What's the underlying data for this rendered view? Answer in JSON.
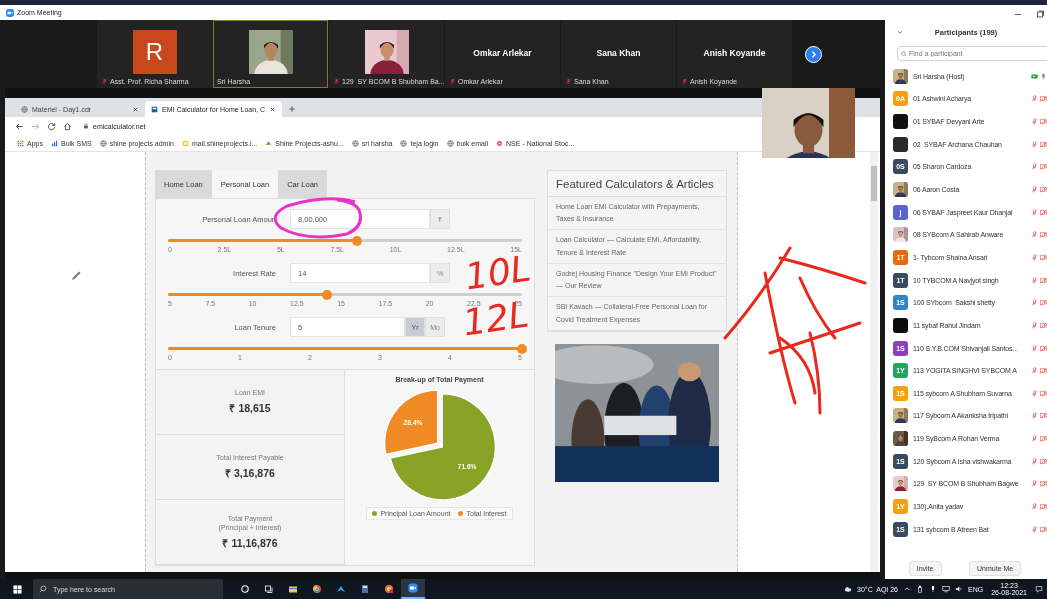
{
  "window": {
    "title": "Zoom Meeting"
  },
  "video_strip": {
    "tiles": [
      {
        "kind": "initial",
        "initial": "R",
        "color": "#c8471b",
        "label": "Asst. Prof. Richa Sharma",
        "muted": true,
        "speaking": false
      },
      {
        "kind": "picture",
        "label": "Sri Harsha",
        "muted": false,
        "speaking": true
      },
      {
        "kind": "picture",
        "label": "129  SY BCOM B Shubham Ba...",
        "muted": true,
        "speaking": false
      },
      {
        "kind": "name",
        "name": "Omkar Arlekar",
        "label": "Omkar Arlekar",
        "muted": true,
        "speaking": false
      },
      {
        "kind": "name",
        "name": "Sana Khan",
        "label": "Sana Khan",
        "muted": true,
        "speaking": false
      },
      {
        "kind": "name",
        "name": "Anish Koyande",
        "label": "Anish Koyande",
        "muted": true,
        "speaking": false
      }
    ]
  },
  "browser": {
    "tabs": [
      {
        "title": "Materiel - Day1.cdr",
        "selected": false
      },
      {
        "title": "EMI Calculator for Home Loan, C",
        "selected": true
      }
    ],
    "address": "emicalculator.net",
    "bookmarks": [
      {
        "kind": "grid",
        "label": "Apps"
      },
      {
        "kind": "bars",
        "label": "Bulk SMS"
      },
      {
        "kind": "globe",
        "label": "shine projects admin"
      },
      {
        "kind": "square",
        "label": "mail.shineprojects.i..."
      },
      {
        "kind": "logo",
        "label": "Shine Projects-ashu..."
      },
      {
        "kind": "globe",
        "label": "sri harsha"
      },
      {
        "kind": "globe",
        "label": "teja login"
      },
      {
        "kind": "globe",
        "label": "bulk email"
      },
      {
        "kind": "dot",
        "label": "NSE - National Stoc..."
      }
    ]
  },
  "calculator": {
    "tabs": [
      {
        "label": "Home Loan",
        "selected": false
      },
      {
        "label": "Personal Loan",
        "selected": true
      },
      {
        "label": "Car Loan",
        "selected": false
      }
    ],
    "inputs": [
      {
        "label": "Personal Loan Amoun",
        "value": "8,00,000",
        "units": [
          {
            "label": "₹",
            "selected": false
          }
        ],
        "level": 0.533,
        "ticks": [
          "0",
          "2.5L",
          "5L",
          "7.5L",
          "10L",
          "12.5L",
          "15L"
        ]
      },
      {
        "label": "Interest Rate",
        "value": "14",
        "units": [
          {
            "label": "%",
            "selected": false
          }
        ],
        "level": 0.45,
        "ticks": [
          "5",
          "7.5",
          "10",
          "12.5",
          "15",
          "17.5",
          "20",
          "22.5",
          "25"
        ]
      },
      {
        "label": "Loan Tenure",
        "value": "5",
        "units": [
          {
            "label": "Yr",
            "selected": true
          },
          {
            "label": "Mo",
            "selected": false
          }
        ],
        "level": 1,
        "ticks": [
          "0",
          "1",
          "2",
          "3",
          "4",
          "5"
        ]
      }
    ],
    "results": [
      {
        "label": "Loan EMI",
        "value": "₹ 18,615"
      },
      {
        "label": "Total Interest Payable",
        "value": "₹ 3,16,876"
      },
      {
        "label": "Total Payment",
        "sublabel": "(Principal + Interest)",
        "value": "₹ 11,16,876"
      }
    ],
    "chart_data": {
      "type": "pie",
      "title": "Break-up of Total Payment",
      "categories": [
        "Principal Loan Amount",
        "Total Interest"
      ],
      "values": [
        71.6,
        28.4
      ],
      "colors": [
        "#88a325",
        "#f08a24"
      ],
      "value_labels": [
        "71.6%",
        "28.4%"
      ],
      "legend": "bottom"
    }
  },
  "sidebar": {
    "heading": "Featured Calculators & Articles",
    "links": [
      "Home Loan EMI Calculator with Prepayments, Taxes & Insurance",
      "Loan Calculator — Calculate EMI, Affordability, Tenure & Interest Rate",
      "Godrej Housing Finance \"Design Your EMI Product\" — Our Review",
      "SBI Kavach — Collateral-Free Personal Loan for Covid Treatment Expenses"
    ]
  },
  "ink": [
    {
      "text": "10L"
    },
    {
      "text": "12L"
    }
  ],
  "participants_panel": {
    "title": "Participants (199)",
    "search_placeholder": "Find a participant",
    "participants": [
      {
        "name": "Sri Harsha (Host)",
        "muted": false,
        "video": true
      },
      {
        "name": "01 Ashwini Acharya",
        "avatar": {
          "kind": "initials",
          "text": "0A",
          "color": "#f5a011"
        },
        "muted": true,
        "video": false
      },
      {
        "name": "01 SYBAF Devyani Arte",
        "avatar": {
          "kind": "blank",
          "color": "#111111"
        },
        "muted": true,
        "video": false
      },
      {
        "name": "02  SYBAF Archana Chauhan",
        "avatar": {
          "kind": "blank",
          "color": "#2a2a2a"
        },
        "muted": true,
        "video": false
      },
      {
        "name": "05 Sharon Cardoza",
        "avatar": {
          "kind": "initials",
          "text": "0S",
          "color": "#3b4a63"
        },
        "muted": true,
        "video": false
      },
      {
        "name": "06 Aaron Costa",
        "muted": true,
        "video": false
      },
      {
        "name": "06 SYBAF Jaspreet Kaur Dhanjal",
        "avatar": {
          "kind": "initials",
          "text": "j",
          "color": "#5b63d3"
        },
        "muted": true,
        "video": false
      },
      {
        "name": "08 SYBcom A Sahirab Anware",
        "muted": true,
        "video": false
      },
      {
        "name": "1- Tybcom Shaina Ansari",
        "avatar": {
          "kind": "initials",
          "text": "1T",
          "color": "#e86a10"
        },
        "muted": true,
        "video": false
      },
      {
        "name": "10 TYBCOM A Navjyot singh",
        "avatar": {
          "kind": "initials",
          "text": "1T",
          "color": "#3b4a63"
        },
        "muted": true,
        "video": false
      },
      {
        "name": "100 SYbcom  Sakshi shetty",
        "avatar": {
          "kind": "initials",
          "text": "1S",
          "color": "#2e86c9"
        },
        "muted": true,
        "video": false
      },
      {
        "name": "11 sybaf Rahul Jindam",
        "avatar": {
          "kind": "blank",
          "color": "#0d0d0d"
        },
        "muted": true,
        "video": false
      },
      {
        "name": "110 S.Y.B.COM Shivanjali Santos...",
        "avatar": {
          "kind": "initials",
          "text": "1S",
          "color": "#8e3fbf"
        },
        "muted": true,
        "video": false
      },
      {
        "name": "113 YOGITA SINGHVI SYBCOM A",
        "avatar": {
          "kind": "initials",
          "text": "1Y",
          "color": "#23a55a"
        },
        "muted": true,
        "video": false
      },
      {
        "name": "115 sybcom A Shubham Suvarna",
        "avatar": {
          "kind": "initials",
          "text": "1S",
          "color": "#f5a011"
        },
        "muted": true,
        "video": false
      },
      {
        "name": "117 Sybcom A Akanksha tripathi",
        "muted": true,
        "video": false
      },
      {
        "name": "119 SyBcom A Rohan Verma",
        "muted": true,
        "video": false
      },
      {
        "name": "120 Sybcom A Isha vishwakarma",
        "avatar": {
          "kind": "initials",
          "text": "1S",
          "color": "#3b4a63"
        },
        "muted": true,
        "video": false
      },
      {
        "name": "129  SY BCOM B Shubham Bagwe",
        "muted": true,
        "video": false
      },
      {
        "name": "130).Anita yadav",
        "avatar": {
          "kind": "initials",
          "text": "1Y",
          "color": "#f5a011"
        },
        "muted": true,
        "video": false
      },
      {
        "name": "131 sybcom B Afreen Bat",
        "avatar": {
          "kind": "initials",
          "text": "1S",
          "color": "#3b4a63"
        },
        "muted": true,
        "video": false
      }
    ],
    "buttons": [
      "Invite",
      "Unmute Me"
    ]
  },
  "taskbar": {
    "search_placeholder": "Type here to search",
    "apps": [
      {
        "kind": "cortana",
        "active": false
      },
      {
        "kind": "taskview",
        "active": false
      },
      {
        "kind": "explorer",
        "active": false
      },
      {
        "kind": "chrome",
        "active": false
      },
      {
        "kind": "arrow",
        "active": false
      },
      {
        "kind": "calculator",
        "active": false
      },
      {
        "kind": "canary",
        "active": false
      },
      {
        "kind": "zoom",
        "active": true
      }
    ],
    "weather": "30°C  AQI 26",
    "language": "ENG",
    "time": "12:23",
    "date": "26-08-2021"
  }
}
